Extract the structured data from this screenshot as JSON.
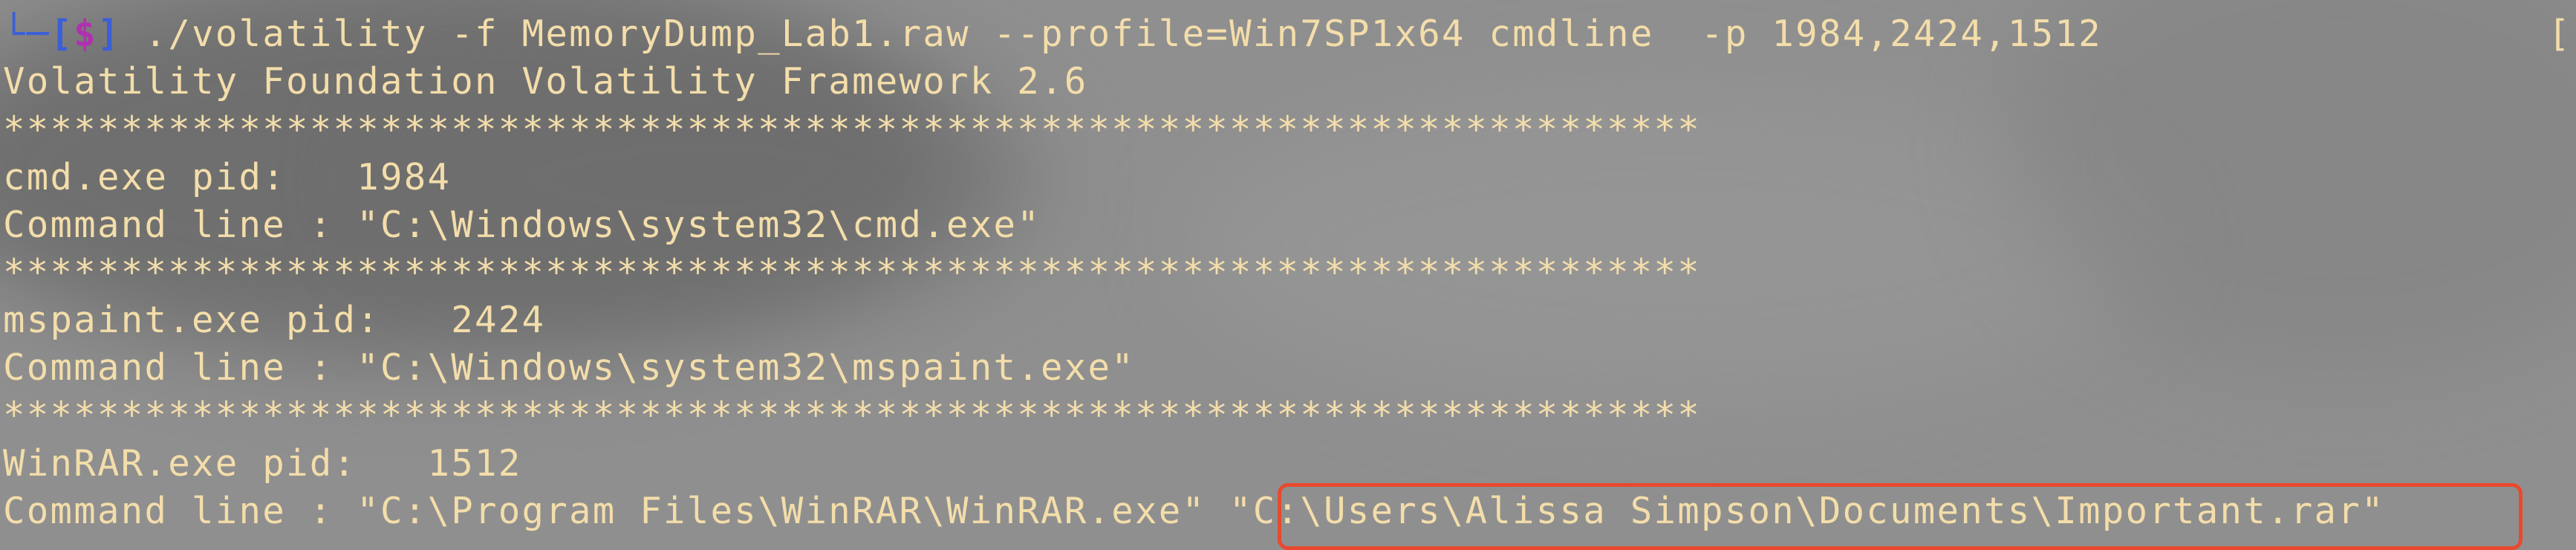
{
  "terminal": {
    "colors": {
      "background": "#8f8f8f",
      "text": "#f3ddaa",
      "prompt_bracket": "#3b5fd8",
      "prompt_dollar": "#b031b0",
      "highlight_border": "#e8492f"
    },
    "prompt": {
      "corner": "└─",
      "open_bracket": "[",
      "symbol": "$",
      "close_bracket": "]",
      "command": " ./volatility -f MemoryDump_Lab1.raw --profile=Win7SP1x64 cmdline  -p 1984,2424,1512",
      "trailing": "["
    },
    "lines": {
      "banner": "Volatility Foundation Volatility Framework 2.6",
      "separator": "************************************************************************",
      "proc1_pid": "cmd.exe pid:   1984",
      "proc1_cmd": "Command line : \"C:\\Windows\\system32\\cmd.exe\"",
      "proc2_pid": "mspaint.exe pid:   2424",
      "proc2_cmd": "Command line : \"C:\\Windows\\system32\\mspaint.exe\"",
      "proc3_pid": "WinRAR.exe pid:   1512",
      "proc3_cmd": "Command line : \"C:\\Program Files\\WinRAR\\WinRAR.exe\" ",
      "proc3_arg": "\"C:\\Users\\Alissa Simpson\\Documents\\Important.rar\""
    }
  }
}
